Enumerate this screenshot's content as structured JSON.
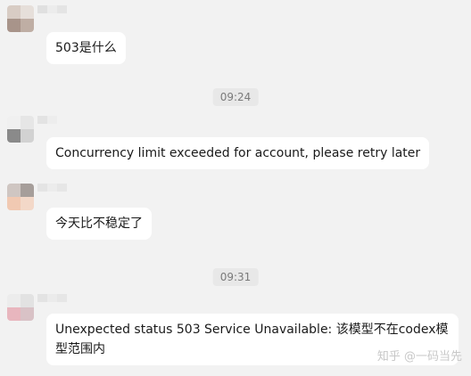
{
  "messages": [
    {
      "text": "503是什么"
    },
    {
      "time": "09:24"
    },
    {
      "text": "Concurrency limit exceeded for account, please retry later"
    },
    {
      "text": "今天比不稳定了"
    },
    {
      "time": "09:31"
    },
    {
      "text": " Unexpected status 503 Service Unavailable: 该模型不在codex模型范围内"
    }
  ],
  "watermark": "知乎 @一码当先",
  "colors": {
    "background": "#f2f2f2",
    "bubble": "#ffffff",
    "time_badge": "#e8e8e8"
  }
}
